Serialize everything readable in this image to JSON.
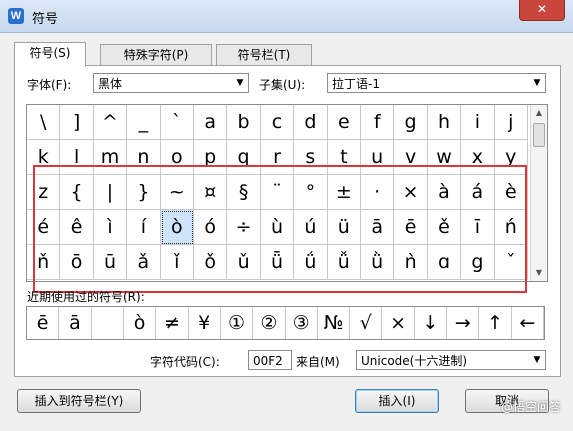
{
  "window": {
    "title": "符号",
    "app_icon": "W",
    "close_label": "✕"
  },
  "tabs": [
    {
      "label": "符号(S)"
    },
    {
      "label": "特殊字符(P)"
    },
    {
      "label": "符号栏(T)"
    }
  ],
  "font": {
    "label": "字体(F):",
    "value": "黑体"
  },
  "subset": {
    "label": "子集(U):",
    "value": "拉丁语-1"
  },
  "symbol_rows": [
    [
      "\\",
      "]",
      "^",
      "_",
      "`",
      "a",
      "b",
      "c",
      "d",
      "e",
      "f",
      "g",
      "h",
      "i",
      "j"
    ],
    [
      "k",
      "l",
      "m",
      "n",
      "o",
      "p",
      "q",
      "r",
      "s",
      "t",
      "u",
      "v",
      "w",
      "x",
      "y"
    ],
    [
      "z",
      "{",
      "|",
      "}",
      "~",
      "¤",
      "§",
      "¨",
      "°",
      "±",
      "·",
      "×",
      "à",
      "á",
      "è"
    ],
    [
      "é",
      "ê",
      "ì",
      "í",
      "ò",
      "ó",
      "÷",
      "ù",
      "ú",
      "ü",
      "ā",
      "ē",
      "ě",
      "ī",
      "ń"
    ],
    [
      "ň",
      "ō",
      "ū",
      "ǎ",
      "ǐ",
      "ǒ",
      "ǔ",
      "ǖ",
      "ǘ",
      "ǚ",
      "ǜ",
      "ǹ",
      "ɑ",
      "g",
      "ˇ"
    ]
  ],
  "recent": {
    "label": "近期使用过的符号(R):",
    "symbols": [
      "ē",
      "ā",
      "",
      "ò",
      "≠",
      "¥",
      "①",
      "②",
      "③",
      "№",
      "√",
      "×",
      "↓",
      "→",
      "↑",
      "←"
    ]
  },
  "char_code": {
    "label": "字符代码(C):",
    "value": "00F2",
    "from_label": "来自(M)",
    "from_value": "Unicode(十六进制)"
  },
  "buttons": {
    "insert_to_bar": "插入到符号栏(Y)",
    "insert": "插入(I)",
    "cancel": "取消"
  },
  "watermark": "@悟空问答",
  "colors": {
    "highlight_border": "#d9363e",
    "selected_cell": "#cfe3fb"
  }
}
